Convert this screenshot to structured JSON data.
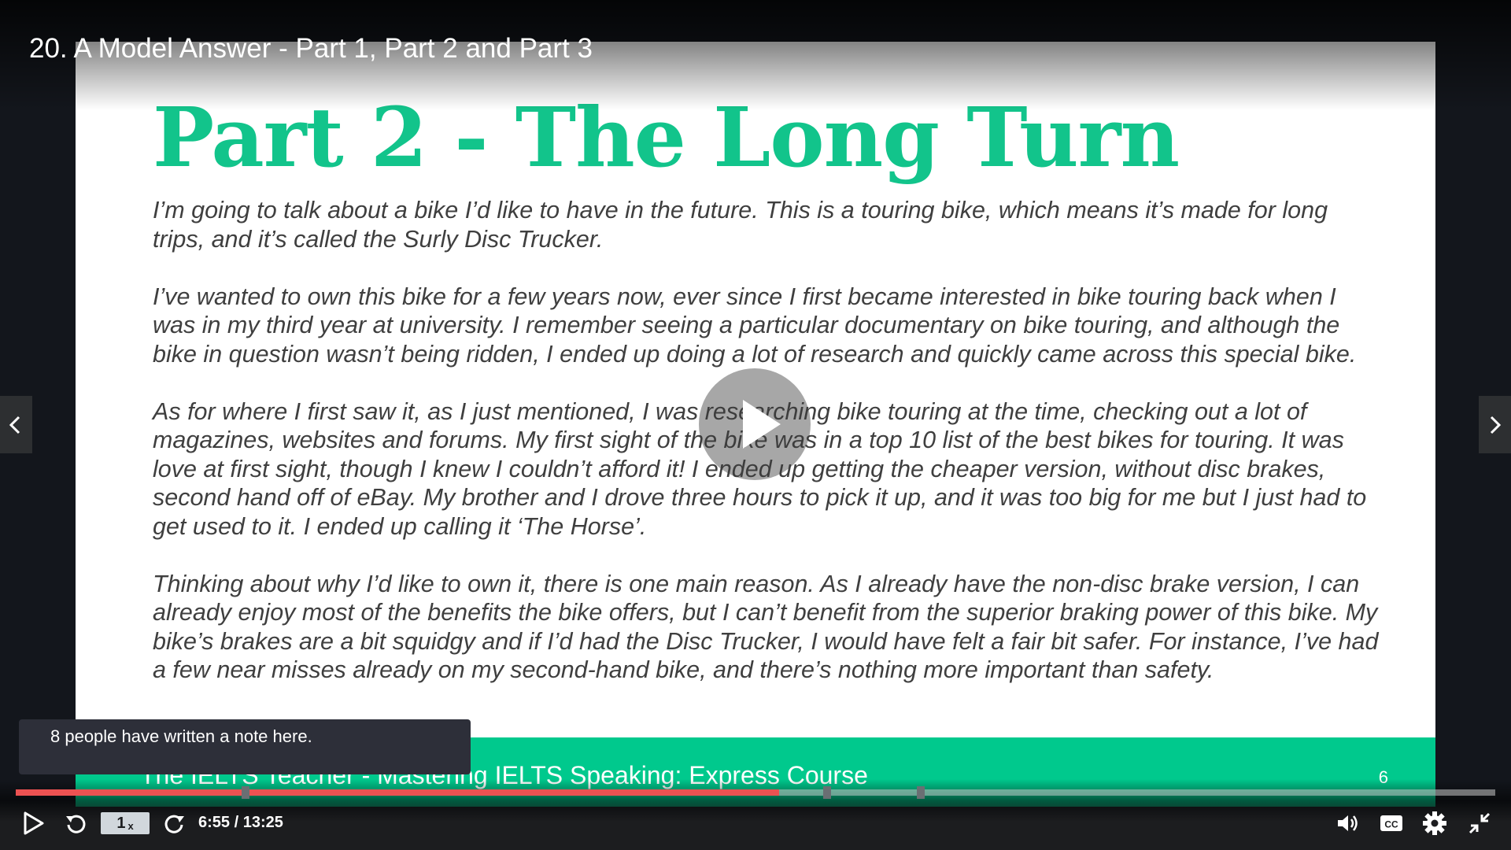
{
  "video": {
    "title": "20. A Model Answer - Part 1, Part 2 and Part 3",
    "progress_fraction": 0.516,
    "time": {
      "current": "6:55",
      "total": "13:25"
    }
  },
  "slide": {
    "heading": "Part 2 - The Long Turn",
    "paragraphs": [
      "I’m going to talk about a bike I’d like to have in the future. This is a touring bike, which means it’s made for long trips, and it’s called the Surly Disc Trucker.",
      "I’ve wanted to own this bike for a few years now, ever since I first became interested in bike touring back when I was in my third year at university. I remember seeing a particular documentary on bike touring, and although the bike in question wasn’t being ridden, I ended up doing a lot of research and quickly came across this special bike.",
      "As for where I first saw it, as I just mentioned, I was researching bike touring at the time, checking out a lot of magazines, websites and forums. My first sight of the bike was in a top 10 list of the best bikes for touring. It was love at first sight, though I knew I couldn’t afford it! I ended up getting the cheaper version, without disc brakes, second hand off of eBay. My brother and I drove three hours to pick it up, and it was too big for me but I just had to get used to it. I ended up calling it ‘The Horse’.",
      "Thinking about why I’d like to own it, there is one main reason. As I already have the non-disc brake version, I can already enjoy most of the benefits the bike offers, but I can’t benefit from the superior braking power of this bike. My bike’s brakes are a bit squidgy and if I’d had the Disc Trucker, I would have felt a fair bit safer. For instance, I’ve had a few near misses already on my second-hand bike, and there’s nothing more important than safety."
    ],
    "footer": "The IELTS Teacher - Mastering IELTS Speaking: Express Course",
    "page_number": "6"
  },
  "tooltip": {
    "text": "8 people have written a note here."
  },
  "controls": {
    "speed_value": "1",
    "speed_suffix": "x"
  },
  "colors": {
    "accent_green": "#12c48b",
    "footer_green": "#00c98d",
    "progress_red": "#ec5252"
  },
  "icons": [
    "play-icon",
    "rewind-icon",
    "forward-icon",
    "volume-icon",
    "cc-icon",
    "settings-icon",
    "exit-fullscreen-icon",
    "chevron-left-icon",
    "chevron-right-icon"
  ]
}
